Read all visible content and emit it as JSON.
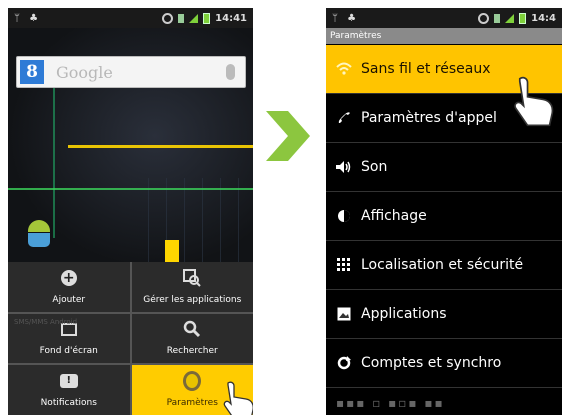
{
  "left_phone": {
    "status_time": "14:41",
    "search_placeholder": "Google",
    "search_logo_letter": "8",
    "menu": [
      {
        "label": "Ajouter",
        "icon": "add-icon"
      },
      {
        "label": "Gérer les applications",
        "icon": "manage-apps-icon"
      },
      {
        "label": "Fond d'écran",
        "icon": "wallpaper-icon"
      },
      {
        "label": "Rechercher",
        "icon": "search-icon"
      },
      {
        "label": "Notifications",
        "icon": "notifications-icon"
      },
      {
        "label": "Paramètres",
        "icon": "settings-icon",
        "selected": true
      }
    ]
  },
  "right_phone": {
    "status_time": "14:4",
    "title": "Paramètres",
    "items": [
      {
        "label": "Sans fil et réseaux",
        "icon": "wifi-icon",
        "selected": true
      },
      {
        "label": "Paramètres d'appel",
        "icon": "phone-icon"
      },
      {
        "label": "Son",
        "icon": "speaker-icon"
      },
      {
        "label": "Affichage",
        "icon": "display-icon"
      },
      {
        "label": "Localisation et sécurité",
        "icon": "location-grid-icon"
      },
      {
        "label": "Applications",
        "icon": "applications-icon"
      },
      {
        "label": "Comptes et synchro",
        "icon": "sync-icon"
      }
    ]
  },
  "colors": {
    "highlight": "#ffcc00",
    "arrow": "#8cc63f"
  }
}
